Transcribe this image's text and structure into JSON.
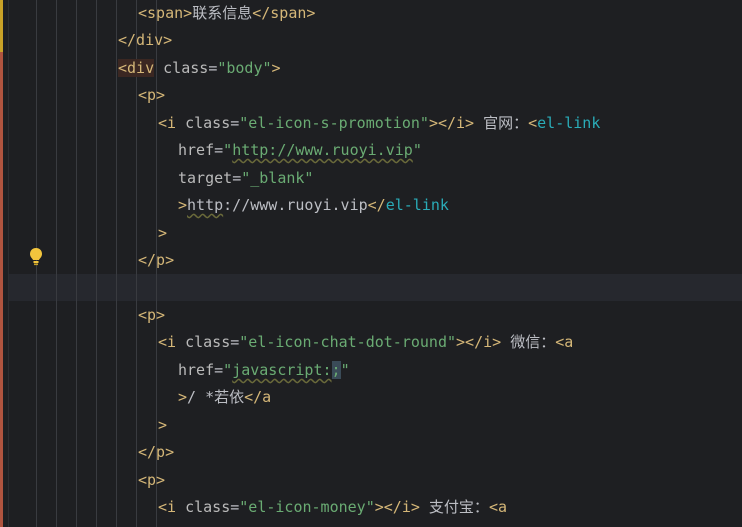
{
  "editor": {
    "lines": [
      {
        "text_parts": [
          [
            "tag",
            "<span>"
          ],
          [
            "txt",
            "联系信息"
          ],
          [
            "tag",
            "</span>"
          ]
        ]
      },
      {
        "text_parts": [
          [
            "tag",
            "</div>"
          ]
        ]
      },
      {
        "text_parts": [
          [
            "tag-hl",
            "<div"
          ],
          [
            "attr",
            " class"
          ],
          [
            "txt",
            "="
          ],
          [
            "val",
            "\"body\""
          ],
          [
            "tag",
            ">"
          ]
        ]
      },
      {
        "text_parts": [
          [
            "tag",
            "<p>"
          ]
        ]
      },
      {
        "text_parts": [
          [
            "tag",
            "<i"
          ],
          [
            "attr",
            " class"
          ],
          [
            "txt",
            "="
          ],
          [
            "val",
            "\"el-icon-s-promotion\""
          ],
          [
            "tag",
            "></i>"
          ],
          [
            "txt",
            " 官网："
          ],
          [
            "tag",
            "<"
          ],
          [
            "link",
            "el-link"
          ]
        ]
      },
      {
        "text_parts": [
          [
            "attr",
            "href"
          ],
          [
            "txt",
            "="
          ],
          [
            "val",
            "\""
          ],
          [
            "val-u",
            "http://www.ruoyi.vip"
          ],
          [
            "val",
            "\""
          ]
        ]
      },
      {
        "text_parts": [
          [
            "attr",
            "target"
          ],
          [
            "txt",
            "="
          ],
          [
            "val",
            "\"_blank\""
          ]
        ]
      },
      {
        "text_parts": [
          [
            "tag",
            ">"
          ],
          [
            "txt-u",
            "http"
          ],
          [
            "txt",
            "://www.ruoyi.vip"
          ],
          [
            "tag",
            "</"
          ],
          [
            "link",
            "el-link"
          ]
        ]
      },
      {
        "text_parts": [
          [
            "tag",
            ">"
          ]
        ]
      },
      {
        "text_parts": [
          [
            "tag",
            "</p>"
          ]
        ]
      },
      {
        "text_parts": []
      },
      {
        "text_parts": [
          [
            "tag",
            "<p>"
          ]
        ]
      },
      {
        "text_parts": [
          [
            "tag",
            "<i"
          ],
          [
            "attr",
            " class"
          ],
          [
            "txt",
            "="
          ],
          [
            "val",
            "\"el-icon-chat-dot-round\""
          ],
          [
            "tag",
            "></i>"
          ],
          [
            "txt",
            " 微信："
          ],
          [
            "tag",
            "<a"
          ]
        ]
      },
      {
        "text_parts": [
          [
            "attr",
            "href"
          ],
          [
            "txt",
            "="
          ],
          [
            "val",
            "\""
          ],
          [
            "val-u",
            "javascript:"
          ],
          [
            "val-caret",
            ";"
          ],
          [
            "val",
            "\""
          ]
        ]
      },
      {
        "text_parts": [
          [
            "tag",
            ">"
          ],
          [
            "txt",
            "/ *若依"
          ],
          [
            "tag",
            "</a"
          ]
        ]
      },
      {
        "text_parts": [
          [
            "tag",
            ">"
          ]
        ]
      },
      {
        "text_parts": [
          [
            "tag",
            "</p>"
          ]
        ]
      },
      {
        "text_parts": [
          [
            "tag",
            "<p>"
          ]
        ]
      },
      {
        "text_parts": [
          [
            "tag",
            "<i"
          ],
          [
            "attr",
            " class"
          ],
          [
            "txt",
            "="
          ],
          [
            "val",
            "\"el-icon-money\""
          ],
          [
            "tag",
            "></i>"
          ],
          [
            "txt",
            " 支付宝："
          ],
          [
            "tag",
            "<a"
          ]
        ]
      }
    ],
    "icons": {
      "gutter_icon": "lightbulb-icon"
    },
    "colors": {
      "background": "#1e1f22",
      "tag": "#d5b778",
      "attribute": "#bababa",
      "string": "#6aab73",
      "text": "#bcbec4",
      "component": "#2aacb8"
    }
  }
}
